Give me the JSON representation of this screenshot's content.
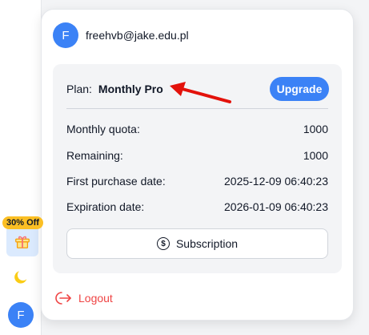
{
  "sidebar": {
    "promo_badge": "30% Off",
    "gift_icon": "gift-icon",
    "theme_icon": "moon-icon",
    "avatar_letter": "F"
  },
  "account": {
    "avatar_letter": "F",
    "email": "freehvb@jake.edu.pl"
  },
  "plan": {
    "label": "Plan:",
    "name": "Monthly Pro",
    "upgrade_label": "Upgrade"
  },
  "details": [
    {
      "label": "Monthly quota:",
      "value": "1000"
    },
    {
      "label": "Remaining:",
      "value": "1000"
    },
    {
      "label": "First purchase date:",
      "value": "2025-12-09 06:40:23"
    },
    {
      "label": "Expiration date:",
      "value": "2026-01-09 06:40:23"
    }
  ],
  "subscription_label": "Subscription",
  "logout_label": "Logout",
  "colors": {
    "accent": "#3b82f6",
    "danger": "#ef4444",
    "promo": "#fbbf24",
    "arrow": "#e3120b"
  }
}
